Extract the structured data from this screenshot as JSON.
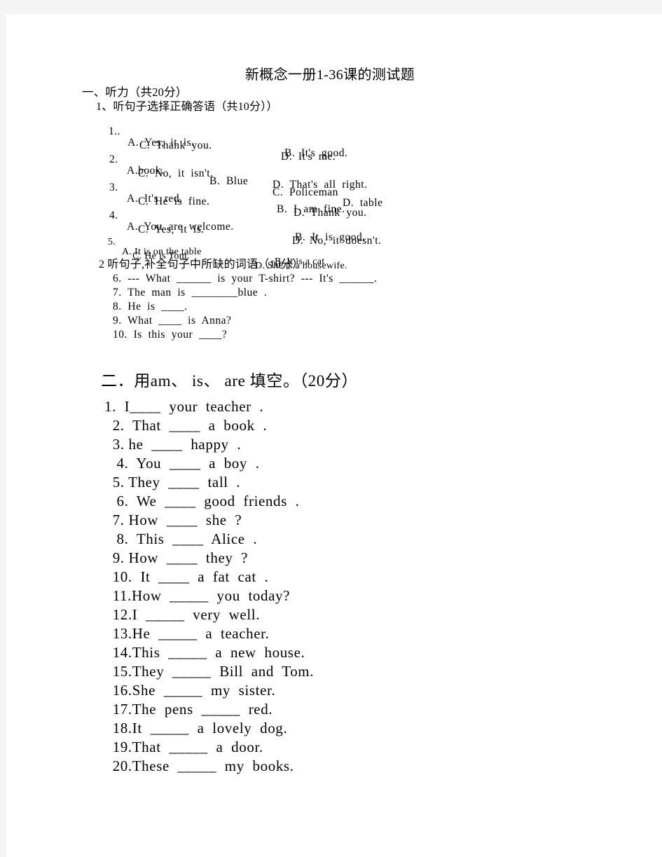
{
  "document": {
    "title": "新概念一册1-36课的测试题"
  },
  "section1": {
    "heading": "一、听力（共20分）",
    "sub1": "1、听句子选择正确答语（共10分））",
    "sub2": "2 听句子,补全句子中所缺的词语（10分）",
    "multiple_choice": [
      {
        "number": "1..",
        "a": "A.  Yes,  it  is.",
        "b": "B.  It's  good.",
        "c": "C.  Thank  you.",
        "d": "D.  It's  me.",
        "layout": "two-line",
        "size": "normal"
      },
      {
        "number": "2.",
        "a": "A.book.",
        "b": "B.  Blue",
        "c": "C.  Policeman",
        "d": "D.  table",
        "c2": "C.  No,  it  isn't.",
        "d2": "D.  That's  all  right.",
        "layout": "four-col",
        "size": "normal"
      },
      {
        "number": "3.",
        "a": "A.  It's  red.",
        "b": "B.  I  am  fine.",
        "c": "C.  He  is  fine.",
        "d": "D.  Thank  you.",
        "layout": "two-line",
        "size": "normal"
      },
      {
        "number": "4.",
        "a": "A.  You  are  welcome.",
        "b": "B.  It  is  good.",
        "c": "C.  Yes,  it  is.",
        "d": "D.  No,  it  doesn't.",
        "layout": "two-line",
        "size": "normal"
      },
      {
        "number": "5.",
        "a": "A. It is on the table",
        "b": "B. It is a cat",
        "c": "C. He is Tom.",
        "d": "D. She is a housewife.",
        "layout": "two-line",
        "size": "small"
      }
    ],
    "fill_blanks": [
      "6.  ---  What  ______  is  your  T-shirt?  ---  It's  ______.",
      "7.  The  man  is  ________blue  .",
      "8.  He  is  ____.",
      "9.  What  ____  is  Anna?",
      "10.  Is  this  your  ____?"
    ]
  },
  "section2": {
    "heading": "二．用am、 is、 are 填空。（20分）",
    "questions": [
      "1.  I____  your  teacher  .",
      "  2.  That  ____  a  book  .",
      "  3. he  ____  happy  .",
      "   4.  You  ____  a  boy  .",
      "  5. They  ____  tall  .",
      "   6.  We  ____  good  friends  .",
      "  7. How  ____  she  ?",
      "   8.  This  ____  Alice  .",
      "  9. How  ____  they  ?",
      "  10.  It  ____  a  fat  cat  .",
      "  11.How  _____  you  today?",
      "  12.I  _____  very  well.",
      "  13.He  _____  a  teacher.",
      "  14.This  _____  a  new  house.",
      "  15.They  _____  Bill  and  Tom.",
      "  16.She  _____  my  sister.",
      "  17.The  pens  _____  red.",
      "  18.It  _____  a  lovely  dog.",
      "  19.That  _____  a  door.",
      "  20.These  _____  my  books."
    ]
  }
}
